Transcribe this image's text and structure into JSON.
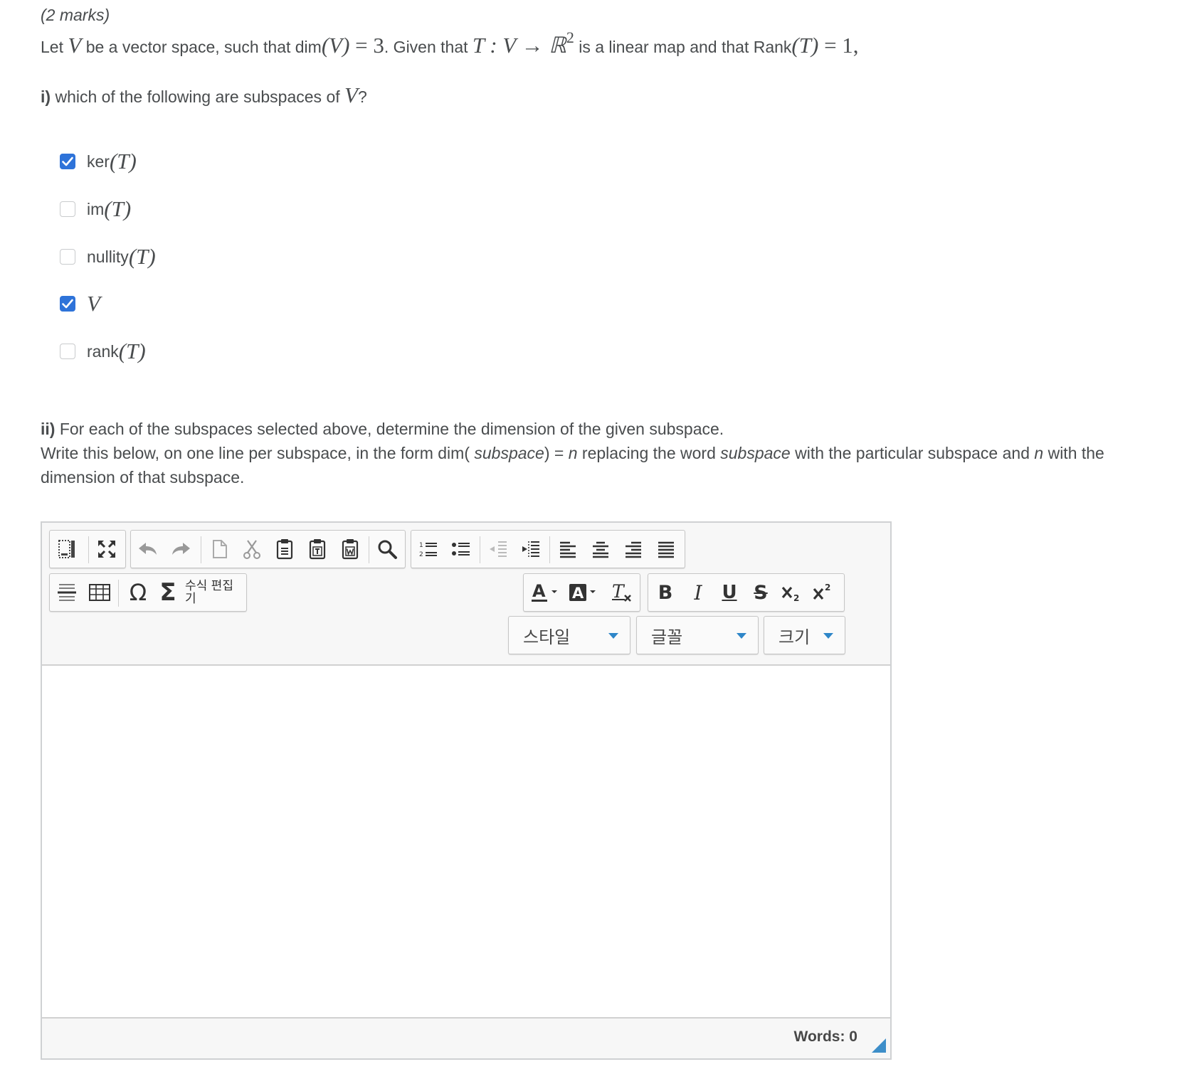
{
  "question": {
    "marks": "(2 marks)",
    "stem": {
      "t1": "Let ",
      "m1": "V",
      "t2": " be a vector space, such that dim",
      "m2": "(V)",
      "m3": " = 3",
      "t3": ". Given that ",
      "m4": "T : V → ℝ",
      "m4sup": "2",
      "t4": " is a linear map and that Rank",
      "m5": "(T)",
      "m6": " = 1,"
    },
    "part1": {
      "label": "i)",
      "text": " which of the following are subspaces of ",
      "var": "V",
      "end": "?"
    },
    "options": [
      {
        "prefix": "ker",
        "math": "(T)",
        "checked": true
      },
      {
        "prefix": "im",
        "math": "(T)",
        "checked": false
      },
      {
        "prefix": "nullity",
        "math": "(T)",
        "checked": false
      },
      {
        "prefix": "",
        "math": "V",
        "checked": true
      },
      {
        "prefix": "rank",
        "math": "(T)",
        "checked": false
      }
    ],
    "part2": {
      "label": "ii)",
      "line1": " For each of the subspaces selected above, determine the dimension of the given subspace.",
      "line2a": "Write this below, on one line per subspace, in the form dim( ",
      "line2b": "subspace",
      "line2c": ") = ",
      "line2d": "n",
      "line2e": " replacing the word ",
      "line2f": "subspace",
      "line2g": " with the particular subspace and ",
      "line2h": "n",
      "line2i": " with the dimension of that subspace."
    }
  },
  "editor": {
    "equation_button": "수식 편집기",
    "style_label": "스타일",
    "font_label": "글꼴",
    "size_label": "크기",
    "word_count": "Words: 0",
    "icons": [
      "source-icon",
      "maximize-icon",
      "undo-icon",
      "redo-icon",
      "new-page-icon",
      "cut-icon",
      "paste-icon",
      "paste-text-icon",
      "paste-word-icon",
      "find-icon",
      "numbered-list-icon",
      "bulleted-list-icon",
      "outdent-icon",
      "indent-icon",
      "align-left-icon",
      "align-center-icon",
      "align-right-icon",
      "justify-icon",
      "horizontal-rule-icon",
      "table-icon",
      "omega-icon",
      "sigma-icon",
      "text-color-icon",
      "background-color-icon",
      "remove-format-icon",
      "bold-icon",
      "italic-icon",
      "underline-icon",
      "strikethrough-icon",
      "subscript-icon",
      "superscript-icon"
    ],
    "check_color": "#2e73d9",
    "caret_color": "#2e86c8"
  }
}
